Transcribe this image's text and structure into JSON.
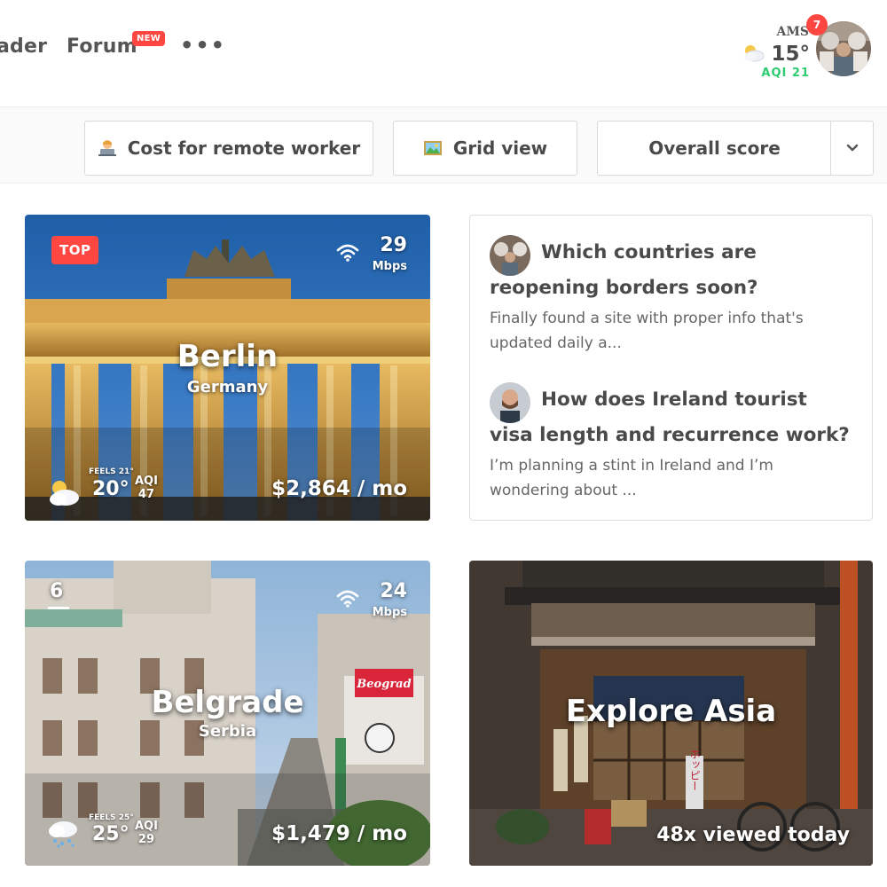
{
  "header": {
    "nav": {
      "leaderboard_partial": "ader",
      "forum": "Forum",
      "forum_badge": "NEW",
      "more": "•••"
    },
    "weather": {
      "city": "AMS",
      "temp": "15°",
      "aqi": "AQI 21",
      "icon": "partly-cloudy-icon"
    },
    "notifications": "7"
  },
  "toolbar": {
    "cost_label": "Cost for remote worker",
    "cost_icon": "remote-worker-emoji-icon",
    "grid_label": "Grid view",
    "grid_icon": "framed-picture-emoji-icon",
    "sort_label": "Overall score",
    "sort_toggle_icon": "chevron-down-icon"
  },
  "cities": [
    {
      "badge": "TOP",
      "name": "Berlin",
      "country": "Germany",
      "wifi_speed": "29",
      "wifi_unit": "Mbps",
      "feels": "FEELS 21°",
      "temp": "20°",
      "aqi_label": "AQI",
      "aqi_value": "47",
      "weather_icon": "partly-cloudy-icon",
      "cost": "$2,864 / mo"
    },
    {
      "rank": "6",
      "name": "Belgrade",
      "country": "Serbia",
      "wifi_speed": "24",
      "wifi_unit": "Mbps",
      "feels": "FEELS 25°",
      "temp": "25°",
      "aqi_label": "AQI",
      "aqi_value": "29",
      "weather_icon": "rain-cloud-icon",
      "cost": "$1,479 / mo",
      "sign_text": "Beograd"
    }
  ],
  "forum": {
    "posts": [
      {
        "title": "Which countries are reopening borders soon?",
        "excerpt": "Finally found a site with proper info that's updated daily a..."
      },
      {
        "title": "How does Ireland tourist visa length and recurrence work?",
        "excerpt": "I’m planning a stint in Ireland and I’m wondering about ..."
      }
    ]
  },
  "explore": {
    "title": "Explore Asia",
    "viewed": "48x viewed today",
    "sign_text": "ホッピー"
  },
  "colors": {
    "accent_red": "#ff4742",
    "aqi_green": "#2ecc71",
    "text_dark": "#4a4a4a"
  }
}
